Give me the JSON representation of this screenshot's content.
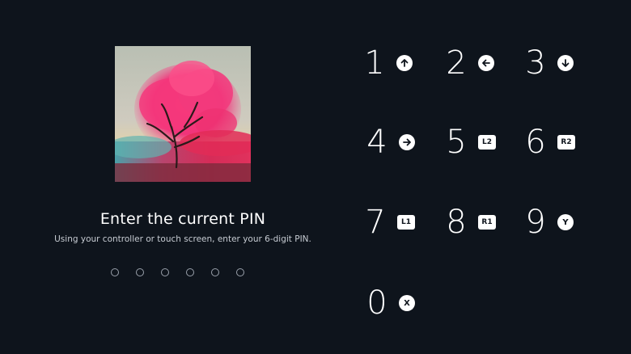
{
  "prompt": {
    "title": "Enter the current PIN",
    "subtitle": "Using your controller or touch screen, enter your 6-digit PIN."
  },
  "pin": {
    "length": 6,
    "entered": 0
  },
  "keypad": [
    {
      "digit": "1",
      "hint_icon": "arrow-up-icon",
      "hint_label": ""
    },
    {
      "digit": "2",
      "hint_icon": "arrow-left-icon",
      "hint_label": ""
    },
    {
      "digit": "3",
      "hint_icon": "arrow-down-icon",
      "hint_label": ""
    },
    {
      "digit": "4",
      "hint_icon": "arrow-right-icon",
      "hint_label": ""
    },
    {
      "digit": "5",
      "hint_icon": "l2-button-icon",
      "hint_label": "L2"
    },
    {
      "digit": "6",
      "hint_icon": "r2-button-icon",
      "hint_label": "R2"
    },
    {
      "digit": "7",
      "hint_icon": "l1-button-icon",
      "hint_label": "L1"
    },
    {
      "digit": "8",
      "hint_icon": "r1-button-icon",
      "hint_label": "R1"
    },
    {
      "digit": "9",
      "hint_icon": "y-button-icon",
      "hint_label": "Y"
    },
    {
      "digit": "0",
      "hint_icon": "x-button-icon",
      "hint_label": "X"
    }
  ],
  "colors": {
    "background": "#0e141c",
    "text": "#ffffff",
    "subtext": "#c7ccd3",
    "pin_dot": "#9aa1ab"
  }
}
